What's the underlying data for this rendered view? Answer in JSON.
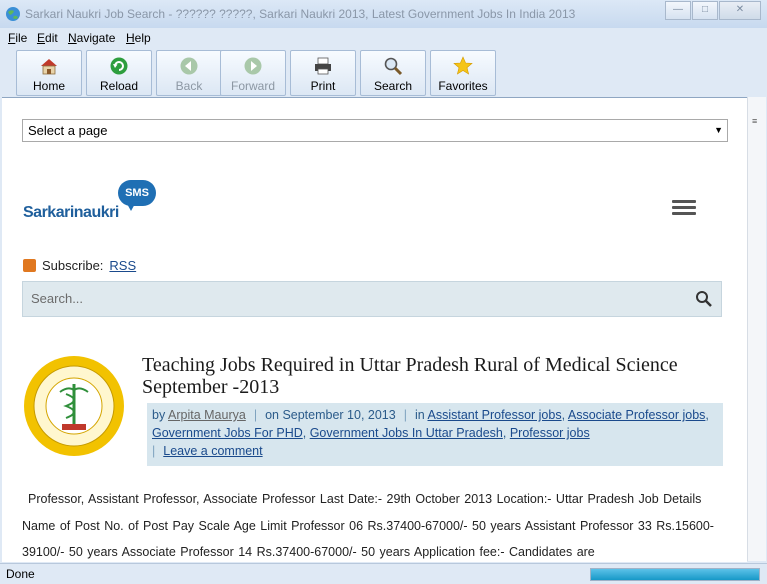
{
  "window": {
    "title": "Sarkari Naukri Job Search - ?????? ?????, Sarkari Naukri 2013, Latest Government Jobs In India 2013"
  },
  "menu": [
    {
      "label": "File",
      "accel": "F",
      "rest": "ile"
    },
    {
      "label": "Edit",
      "accel": "E",
      "rest": "dit"
    },
    {
      "label": "Navigate",
      "accel": "N",
      "rest": "avigate"
    },
    {
      "label": "Help",
      "accel": "H",
      "rest": "elp"
    }
  ],
  "toolbar": {
    "home": "Home",
    "reload": "Reload",
    "back": "Back",
    "forward": "Forward",
    "print": "Print",
    "search": "Search",
    "favorites": "Favorites"
  },
  "page": {
    "select_value": "Select a page",
    "logo_text": "Sarkarinaukri",
    "logo_badge": "SMS",
    "subscribe_label": "Subscribe:",
    "rss_link": "RSS",
    "search_placeholder": "Search...",
    "post": {
      "title": "Teaching Jobs Required in Uttar Pradesh Rural of Medical Science September -2013",
      "by": "by",
      "author": "Arpita Maurya",
      "date": "on September 10, 2013",
      "in": "in",
      "categories": [
        "Assistant Professor jobs",
        "Associate Professor jobs",
        "Government Jobs For PHD",
        "Government Jobs In Uttar Pradesh",
        "Professor jobs"
      ],
      "comment_link": "Leave a comment",
      "body": "Professor, Assistant Professor, Associate Professor Last Date:- 29th October 2013 Location:- Uttar Pradesh        Job Details Name of Post No. of Post Pay Scale Age Limit Professor 06 Rs.37400-67000/- 50 years Assistant Professor 33 Rs.15600-39100/- 50 years Associate Professor 14 Rs.37400-67000/- 50 years   Application fee:- Candidates are"
    }
  },
  "status": {
    "text": "Done",
    "progress": 1.0
  },
  "colors": {
    "accent": "#1f6fb4",
    "link": "#1a4a8c",
    "meta_bg": "#d7e6ee"
  }
}
